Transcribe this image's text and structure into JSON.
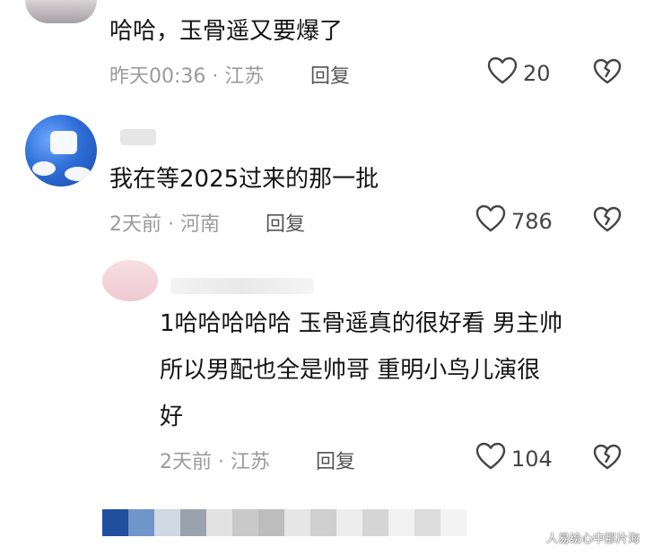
{
  "comments": [
    {
      "text": "哈哈，玉骨遥又要爆了",
      "meta": "昨天00:36 · 江苏",
      "reply_label": "回复",
      "likes": "20"
    },
    {
      "text": "我在等2025过来的那一批",
      "meta": "2天前 · 河南",
      "reply_label": "回复",
      "likes": "786"
    },
    {
      "text_lines": [
        "1哈哈哈哈哈 玉骨遥真的很好看 男主帅",
        "所以男配也全是帅哥 重明小鸟儿演很",
        "好"
      ],
      "meta": "2天前 · 江苏",
      "reply_label": "回复",
      "likes": "104"
    }
  ],
  "watermark": "人易绘心中那片海",
  "icons": {
    "like": "heart-outline-icon",
    "dislike": "broken-heart-icon"
  },
  "colors": {
    "meta_gray": "#9a9a9a",
    "text": "#141414",
    "avatar_blue": "#2f6fd8"
  }
}
